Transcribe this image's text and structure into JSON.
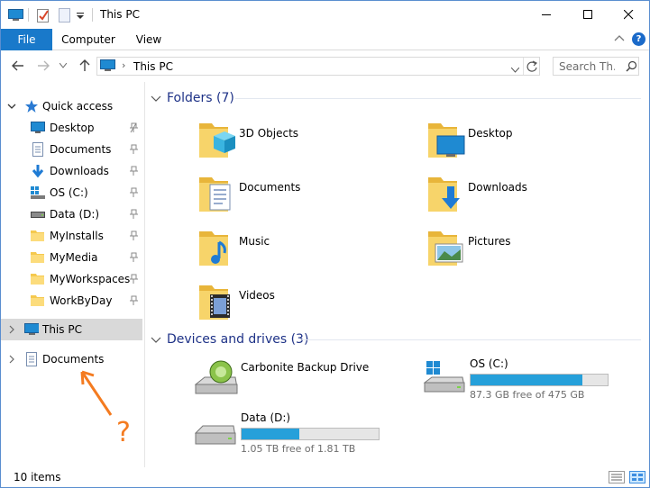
{
  "window": {
    "title": "This PC",
    "minimize_label": "",
    "maximize_label": "",
    "close_label": ""
  },
  "ribbon": {
    "tabs": [
      "File",
      "Computer",
      "View"
    ],
    "help_label": "?"
  },
  "navbar": {
    "path_segment": "This PC",
    "search_placeholder": "Search Th..."
  },
  "nav_pane": {
    "quick_access_label": "Quick access",
    "quick_items": [
      {
        "label": "Desktop",
        "icon": "desktop-icon"
      },
      {
        "label": "Documents",
        "icon": "documents-icon"
      },
      {
        "label": "Downloads",
        "icon": "downloads-icon"
      },
      {
        "label": "OS (C:)",
        "icon": "windows-drive-icon"
      },
      {
        "label": "Data (D:)",
        "icon": "drive-icon"
      },
      {
        "label": "MyInstalls",
        "icon": "folder-icon"
      },
      {
        "label": "MyMedia",
        "icon": "folder-icon"
      },
      {
        "label": "MyWorkspaces",
        "icon": "folder-icon"
      },
      {
        "label": "WorkByDay",
        "icon": "folder-icon"
      }
    ],
    "this_pc_label": "This PC",
    "documents_label": "Documents"
  },
  "content": {
    "folders_header": "Folders (7)",
    "folders": [
      {
        "label": "3D Objects",
        "icon": "3d-objects-icon"
      },
      {
        "label": "Desktop",
        "icon": "desktop-folder-icon"
      },
      {
        "label": "Documents",
        "icon": "documents-folder-icon"
      },
      {
        "label": "Downloads",
        "icon": "downloads-folder-icon"
      },
      {
        "label": "Music",
        "icon": "music-folder-icon"
      },
      {
        "label": "Pictures",
        "icon": "pictures-folder-icon"
      },
      {
        "label": "Videos",
        "icon": "videos-folder-icon"
      }
    ],
    "drives_header": "Devices and drives (3)",
    "drives": [
      {
        "label": "Carbonite Backup Drive",
        "free_text": "",
        "used_fraction": null
      },
      {
        "label": "OS (C:)",
        "free_text": "87.3 GB free of 475 GB",
        "used_fraction": 0.816
      },
      {
        "label": "Data (D:)",
        "free_text": "1.05 TB free of 1.81 TB",
        "used_fraction": 0.42
      }
    ]
  },
  "status": {
    "items_text": "10 items"
  },
  "annotation": {
    "question_mark": "?",
    "color": "#f47b20"
  },
  "colors": {
    "accent": "#1979ca",
    "folder": "#f5c94f",
    "drive_bar": "#26a0da",
    "group_header": "#1e3287"
  }
}
